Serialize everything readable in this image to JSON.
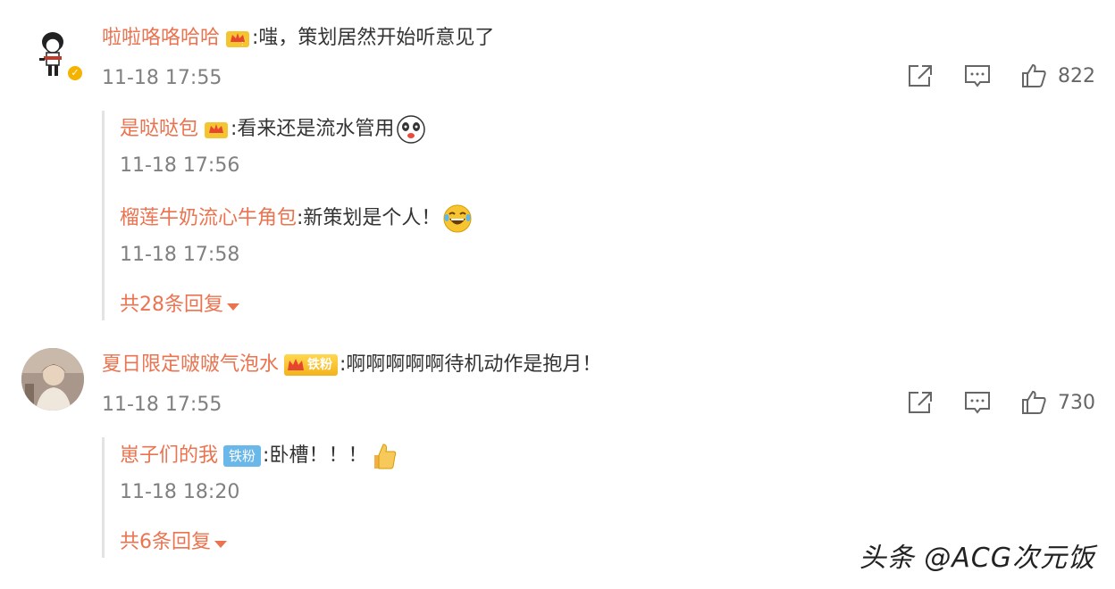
{
  "comments": [
    {
      "username": "啦啦咯咯哈哈",
      "text": ":嗤，策划居然开始听意见了",
      "time": "11-18 17:55",
      "likes": "822",
      "replies": [
        {
          "username": "是哒哒包",
          "text": ":看来还是流水管用",
          "time": "11-18 17:56"
        },
        {
          "username": "榴莲牛奶流心牛角包",
          "text": ":新策划是个人！",
          "time": "11-18 17:58"
        }
      ],
      "more_replies": "共28条回复"
    },
    {
      "username": "夏日限定啵啵气泡水",
      "badge": "铁粉",
      "text": ":啊啊啊啊啊待机动作是抱月！",
      "time": "11-18 17:55",
      "likes": "730",
      "replies": [
        {
          "username": "崽子们的我",
          "badge": "铁粉",
          "text": ":卧槽！！！",
          "time": "11-18 18:20"
        }
      ],
      "more_replies": "共6条回复"
    }
  ],
  "watermark": "头条 @ACG次元饭",
  "colors": {
    "name": "#eb7350",
    "time": "#808080",
    "text": "#333333"
  }
}
